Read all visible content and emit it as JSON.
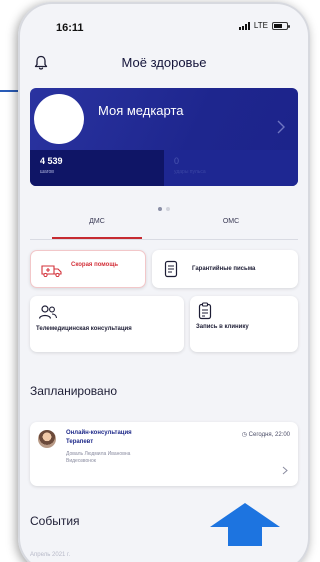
{
  "status_bar": {
    "time": "16:11",
    "network": "LTE"
  },
  "header": {
    "title": "Моё здоровье",
    "icon": "bell-icon"
  },
  "medcard": {
    "title": "Моя медкарта",
    "stats": [
      {
        "value": "4 539",
        "label": "шагов"
      },
      {
        "value": "0",
        "label": "удары пульса"
      }
    ]
  },
  "carousel": {
    "pages": 2,
    "active": 1
  },
  "tabs": {
    "items": [
      "ДМС",
      "ОМС"
    ],
    "active": "ДМС"
  },
  "tiles": [
    {
      "label": "Скорая помощь",
      "icon": "ambulance-icon"
    },
    {
      "label": "Гарантийные письма",
      "icon": "document-icon"
    },
    {
      "label": "Телемедицинская консультация",
      "icon": "people-icon"
    },
    {
      "label": "Запись в клинику",
      "icon": "clipboard-icon"
    }
  ],
  "planned": {
    "title": "Запланировано",
    "appointment": {
      "title": "Онлайн-консультация",
      "specialty": "Терапевт",
      "doctor": "Доваль Людмила Ивановна",
      "type": "Видеозвонок",
      "time": "Сегодня, 22:00"
    }
  },
  "events": {
    "title": "События",
    "subtitle": "Апрель 2021 г."
  },
  "colors": {
    "brand_blue": "#1e268e",
    "accent_red": "#d3313a",
    "arrow_blue": "#1d74e0"
  }
}
